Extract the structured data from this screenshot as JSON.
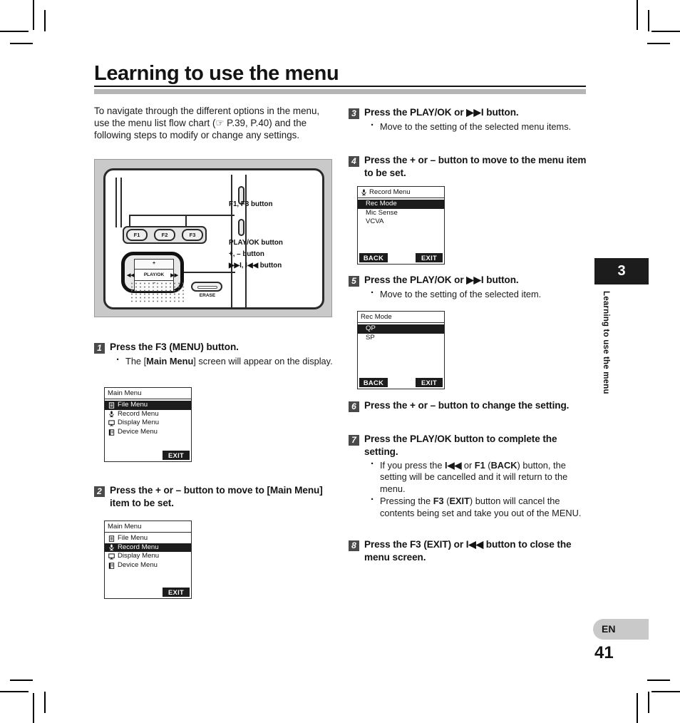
{
  "document": {
    "title": "Learning to use the menu",
    "intro": "To navigate through the different options in the menu, use the menu list flow chart (☞ P.39, P.40) and the following steps to modify or change any settings.",
    "chapter_number": "3",
    "chapter_vertical_label": "Learning to use the menu",
    "language_badge": "EN",
    "page_number": "41"
  },
  "device_figure": {
    "callouts": [
      {
        "name": "f-buttons",
        "text": "F1, F3 button"
      },
      {
        "name": "playok-button",
        "text": "PLAY/OK button"
      },
      {
        "name": "plus-minus-button",
        "text": "+, – button"
      },
      {
        "name": "skip-buttons",
        "text": "▶▶I, I◀◀ button"
      }
    ],
    "buttons": {
      "f1": "F1",
      "f2": "F2",
      "f3": "F3",
      "plus": "+",
      "minus": "–",
      "playok": "PLAY/OK",
      "rew": "◀◀",
      "ff": "▶▶",
      "erase": "ERASE"
    }
  },
  "steps": [
    {
      "number": "1",
      "title_parts": [
        {
          "t": "Press the F3 (MENU) button.",
          "b": false
        }
      ],
      "bullets": [
        {
          "parts": [
            {
              "t": "The [",
              "b": false
            },
            {
              "t": "Main Menu",
              "b": true
            },
            {
              "t": "] screen will appear on the display.",
              "b": false
            }
          ]
        }
      ]
    },
    {
      "number": "2",
      "title_parts": [
        {
          "t": "Press the + or – button to move to [",
          "b": false
        },
        {
          "t": "Main Menu",
          "b": true
        },
        {
          "t": "] item to be set.",
          "b": false
        }
      ],
      "bullets": []
    },
    {
      "number": "3",
      "title_parts": [
        {
          "t": "Press the PLAY/OK or ▶▶I button.",
          "b": false
        }
      ],
      "bullets": [
        {
          "parts": [
            {
              "t": "Move to the setting of the selected menu items.",
              "b": false
            }
          ]
        }
      ]
    },
    {
      "number": "4",
      "title_parts": [
        {
          "t": "Press the + or – button to move to the menu item to be set.",
          "b": false
        }
      ],
      "bullets": []
    },
    {
      "number": "5",
      "title_parts": [
        {
          "t": "Press the PLAY/OK or ▶▶I button.",
          "b": false
        }
      ],
      "bullets": [
        {
          "parts": [
            {
              "t": "Move to the setting of the selected item.",
              "b": false
            }
          ]
        }
      ]
    },
    {
      "number": "6",
      "title_parts": [
        {
          "t": "Press the + or – button to change the setting.",
          "b": false
        }
      ],
      "bullets": []
    },
    {
      "number": "7",
      "title_parts": [
        {
          "t": "Press the PLAY/OK button to complete the setting.",
          "b": false
        }
      ],
      "bullets": [
        {
          "parts": [
            {
              "t": "If you press the ",
              "b": false
            },
            {
              "t": "I◀◀",
              "b": true
            },
            {
              "t": " or ",
              "b": false
            },
            {
              "t": "F1",
              "b": true
            },
            {
              "t": " (",
              "b": false
            },
            {
              "t": "BACK",
              "b": true
            },
            {
              "t": ") button, the setting will be cancelled and it will return to the menu.",
              "b": false
            }
          ]
        },
        {
          "parts": [
            {
              "t": "Pressing the ",
              "b": false
            },
            {
              "t": "F3",
              "b": true
            },
            {
              "t": " (",
              "b": false
            },
            {
              "t": "EXIT",
              "b": true
            },
            {
              "t": ") button will cancel the contents being set and take you out of the MENU.",
              "b": false
            }
          ]
        }
      ]
    },
    {
      "number": "8",
      "title_parts": [
        {
          "t": "Press the F3 (EXIT) or I◀◀ button to close the menu screen.",
          "b": false
        }
      ],
      "bullets": []
    }
  ],
  "screens": [
    {
      "id": "main-menu-file",
      "title": "Main Menu",
      "title_icon": "",
      "rows": [
        {
          "label": "File Menu",
          "icon": "file-icon",
          "selected": true
        },
        {
          "label": "Record Menu",
          "icon": "mic-icon",
          "selected": false
        },
        {
          "label": "Display Menu",
          "icon": "monitor-icon",
          "selected": false
        },
        {
          "label": "Device Menu",
          "icon": "device-icon",
          "selected": false
        }
      ],
      "soft_keys": {
        "back": "",
        "exit": "EXIT"
      }
    },
    {
      "id": "main-menu-record",
      "title": "Main Menu",
      "title_icon": "",
      "rows": [
        {
          "label": "File Menu",
          "icon": "file-icon",
          "selected": false
        },
        {
          "label": "Record Menu",
          "icon": "mic-icon",
          "selected": true
        },
        {
          "label": "Display Menu",
          "icon": "monitor-icon",
          "selected": false
        },
        {
          "label": "Device Menu",
          "icon": "device-icon",
          "selected": false
        }
      ],
      "soft_keys": {
        "back": "",
        "exit": "EXIT"
      }
    },
    {
      "id": "record-menu",
      "title": "Record Menu",
      "title_icon": "mic-icon",
      "rows": [
        {
          "label": "Rec Mode",
          "icon": "",
          "selected": true
        },
        {
          "label": "Mic Sense",
          "icon": "",
          "selected": false
        },
        {
          "label": "VCVA",
          "icon": "",
          "selected": false
        }
      ],
      "soft_keys": {
        "back": "BACK",
        "exit": "EXIT"
      }
    },
    {
      "id": "rec-mode",
      "title": "Rec Mode",
      "title_icon": "",
      "rows": [
        {
          "label": "QP",
          "icon": "",
          "selected": true
        },
        {
          "label": "SP",
          "icon": "",
          "selected": false
        }
      ],
      "soft_keys": {
        "back": "BACK",
        "exit": "EXIT"
      }
    }
  ],
  "colors": {
    "ink": "#141414",
    "step_badge": "#4a4a4a",
    "rule_grey": "#b5b5b5",
    "figure_bg": "#c9c9c9",
    "lcd_select": "#1c1c1c"
  }
}
